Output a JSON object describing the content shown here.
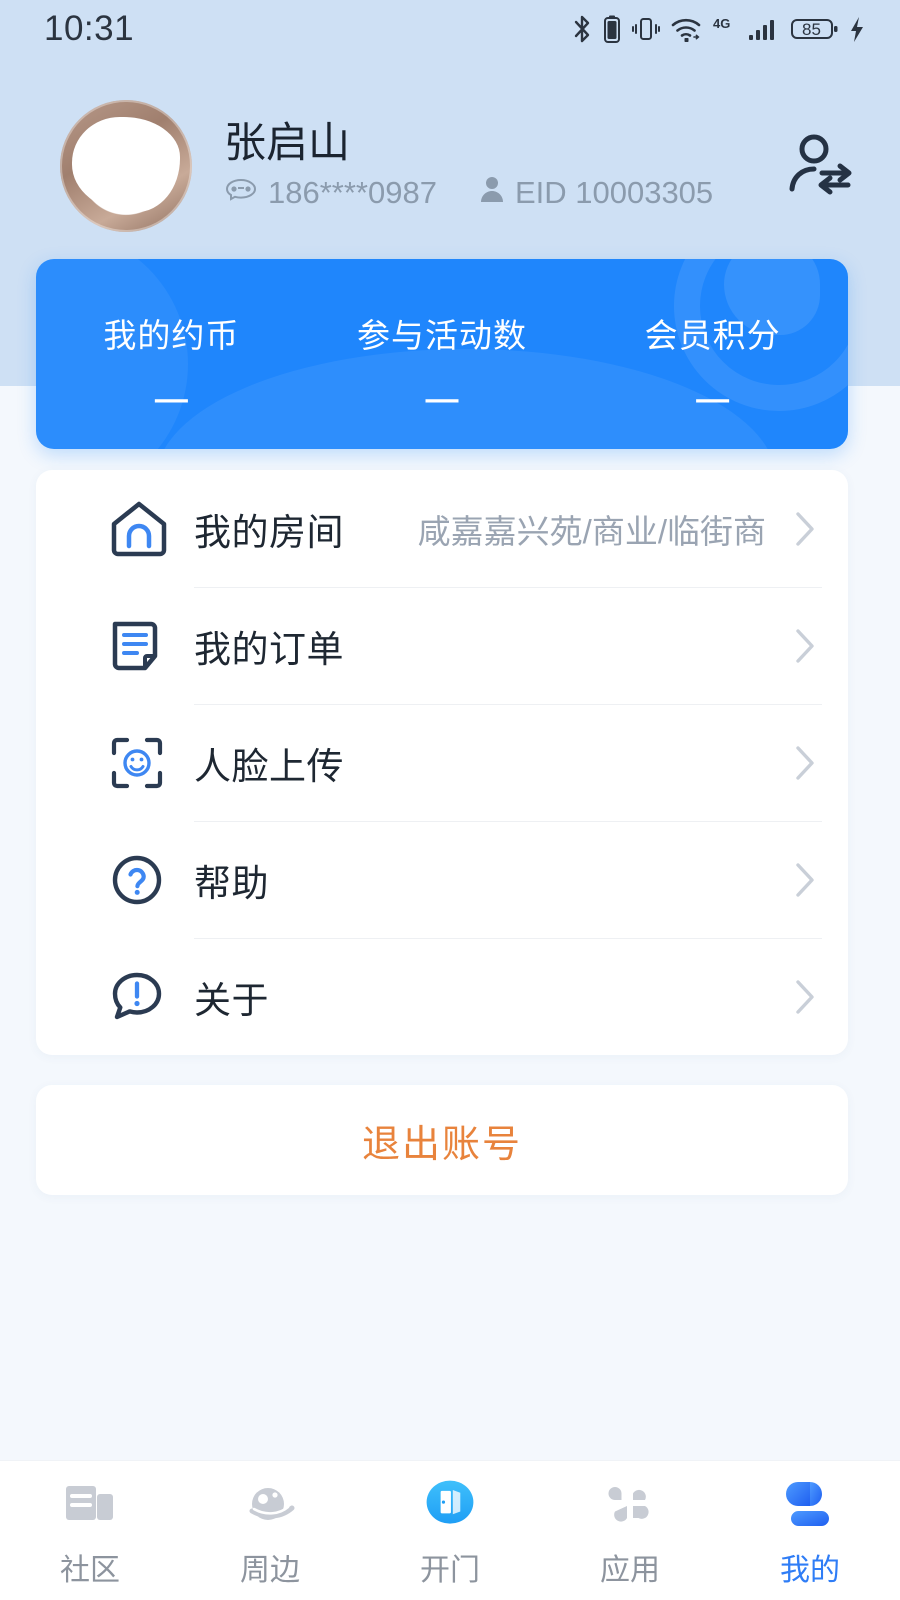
{
  "status_bar": {
    "time": "10:31",
    "battery_level": "85",
    "network": "4G",
    "icons": [
      "bluetooth-icon",
      "bluetooth-battery-icon",
      "vibrate-icon",
      "wifi-icon",
      "network-4g-icon",
      "signal-bars-icon",
      "battery-icon",
      "charging-bolt-icon"
    ]
  },
  "profile": {
    "name": "张启山",
    "phone": "186****0987",
    "eid": "EID 10003305",
    "phone_icon": "telephone-icon",
    "eid_icon": "person-icon",
    "switch_account_icon": "switch-user-icon",
    "avatar_alt": "user-avatar"
  },
  "stats": {
    "items": [
      {
        "label": "我的约币",
        "value": "—"
      },
      {
        "label": "参与活动数",
        "value": "—"
      },
      {
        "label": "会员积分",
        "value": "—"
      }
    ]
  },
  "menu": {
    "items": [
      {
        "label": "我的房间",
        "value": "咸嘉嘉兴苑/商业/临街商",
        "icon": "home-icon"
      },
      {
        "label": "我的订单",
        "value": "",
        "icon": "order-document-icon"
      },
      {
        "label": "人脸上传",
        "value": "",
        "icon": "face-scan-icon"
      },
      {
        "label": "帮助",
        "value": "",
        "icon": "question-circle-icon"
      },
      {
        "label": "关于",
        "value": "",
        "icon": "info-bubble-icon"
      }
    ]
  },
  "logout": {
    "label": "退出账号",
    "color": "#e8833c"
  },
  "tabbar": {
    "items": [
      {
        "label": "社区",
        "icon": "newspaper-icon",
        "active": false
      },
      {
        "label": "周边",
        "icon": "planet-icon",
        "active": false
      },
      {
        "label": "开门",
        "icon": "open-door-icon",
        "active": false
      },
      {
        "label": "应用",
        "icon": "apps-grid-icon",
        "active": false
      },
      {
        "label": "我的",
        "icon": "person-icon",
        "active": true
      }
    ]
  },
  "theme": {
    "header_bg": "#cee0f4",
    "page_bg": "#f4f8fd",
    "accent_blue": "#1f86fc",
    "active_tab": "#2f7df6",
    "logout_orange": "#e8833c"
  }
}
